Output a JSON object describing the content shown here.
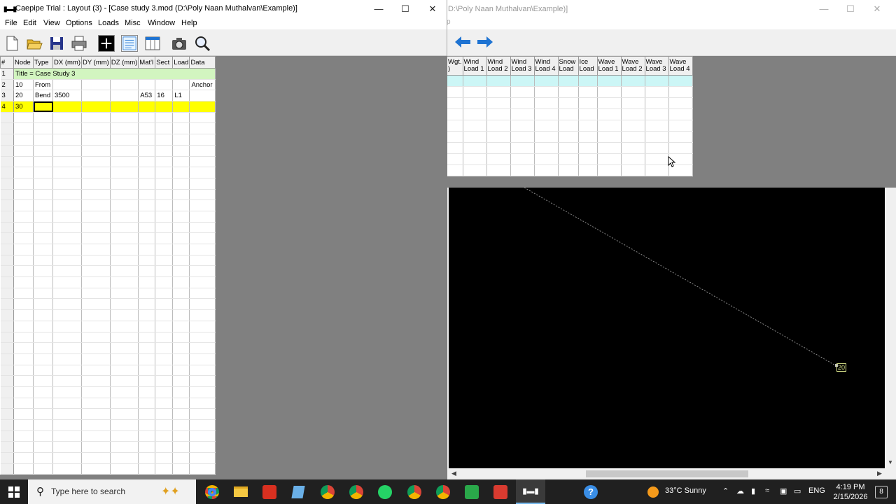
{
  "left_window": {
    "title": "Caepipe Trial : Layout  (3)  -  [Case study 3.mod (D:\\Poly Naan Muthalvan\\Example)]",
    "app_icon": "caepipe-icon",
    "menu": [
      "File",
      "Edit",
      "View",
      "Options",
      "Loads",
      "Misc",
      "Window",
      "Help"
    ],
    "toolbar_icons": [
      "new-file-icon",
      "open-folder-icon",
      "save-icon",
      "print-icon",
      "crosshair-icon",
      "list-view-icon",
      "table-view-icon",
      "camera-icon",
      "zoom-icon"
    ],
    "grid": {
      "headers": [
        "#",
        "Node",
        "Type",
        "DX (mm)",
        "DY (mm)",
        "DZ (mm)",
        "Mat'l",
        "Sect",
        "Load",
        "Data"
      ],
      "title_row": {
        "num": "1",
        "text": "Title = Case Study 3"
      },
      "rows": [
        {
          "num": "2",
          "node": "10",
          "type": "From",
          "dx": "",
          "dy": "",
          "dz": "",
          "matl": "",
          "sect": "",
          "load": "",
          "data": "Anchor"
        },
        {
          "num": "3",
          "node": "20",
          "type": "Bend",
          "dx": "3500",
          "dy": "",
          "dz": "",
          "matl": "A53",
          "sect": "16",
          "load": "L1",
          "data": ""
        }
      ],
      "current_row": {
        "num": "4",
        "node": "30"
      },
      "empty_row_count": 33
    }
  },
  "right_window": {
    "title": "D:\\Poly Naan Muthalvan\\Example)]",
    "menu_fragment": "p",
    "grid": {
      "headers": [
        "Wgt.\n)",
        "Wind\nLoad 1",
        "Wind\nLoad 2",
        "Wind\nLoad 3",
        "Wind\nLoad 4",
        "Snow\nLoad",
        "Ice\nLoad",
        "Wave\nLoad 1",
        "Wave\nLoad 2",
        "Wave\nLoad 3",
        "Wave\nLoad 4"
      ],
      "row_count": 9
    },
    "canvas": {
      "node_label": "20"
    }
  },
  "taskbar": {
    "search_placeholder": "Type here to search",
    "weather": "33°C  Sunny",
    "language": "ENG",
    "time": "4:19 PM",
    "date": "2/15/2026",
    "notification_count": "8"
  },
  "colors": {
    "title_row": "#d2f5c0",
    "current_row": "#ffff00",
    "selected_row_right": "#ccf6f6",
    "arrow_blue": "#1e73d2",
    "canvas_bg": "#000000"
  }
}
